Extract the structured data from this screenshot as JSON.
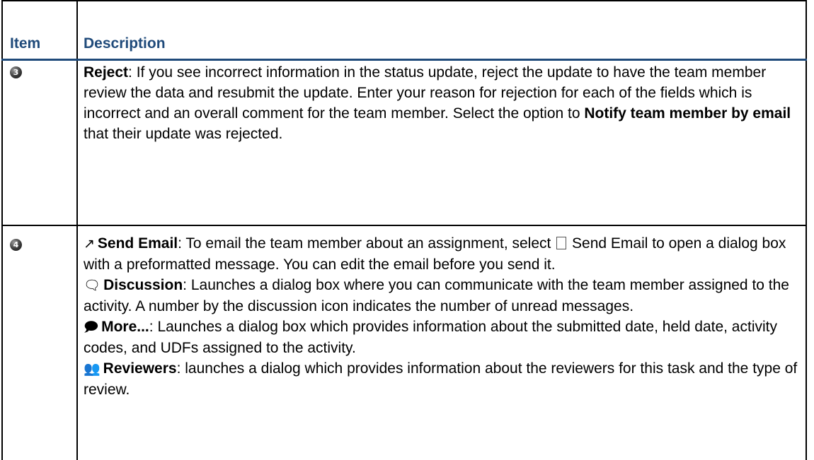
{
  "table": {
    "headers": {
      "item": "Item",
      "description": "Description"
    },
    "rows": [
      {
        "callout": "3",
        "paragraphs": [
          {
            "term": "Reject",
            "text_1": ":   If you see incorrect information in the status update, reject the update to have the team member review the data and resubmit the update. Enter your reason for rejection for each of the fields which is incorrect and an overall comment for the team member. Select the option to ",
            "emphasis": "Notify team member by email",
            "text_2": " that their update was rejected."
          }
        ]
      },
      {
        "callout": "4",
        "paragraphs": [
          {
            "icon": "send-email-icon",
            "term": "Send Email",
            "text_1": ": To email the team member about an assignment, select ",
            "text_2": " Send Email to open a dialog box with a preformatted message. You can edit the email before you send it."
          },
          {
            "icon": "discussion-icon",
            "term": "Discussion",
            "text_1": ": Launches a dialog box where you can communicate with the team member assigned to the activity. A number by the discussion icon indicates the number of unread messages."
          },
          {
            "icon": "more-icon",
            "term": "More...",
            "text_1": ": Launches a dialog box which provides information about the submitted date, held date, activity codes, and UDFs assigned to the activity."
          },
          {
            "icon": "reviewers-icon",
            "term": "Reviewers",
            "text_1": ": launches a dialog which provides information about the reviewers for this task and the type of review."
          }
        ]
      }
    ]
  }
}
